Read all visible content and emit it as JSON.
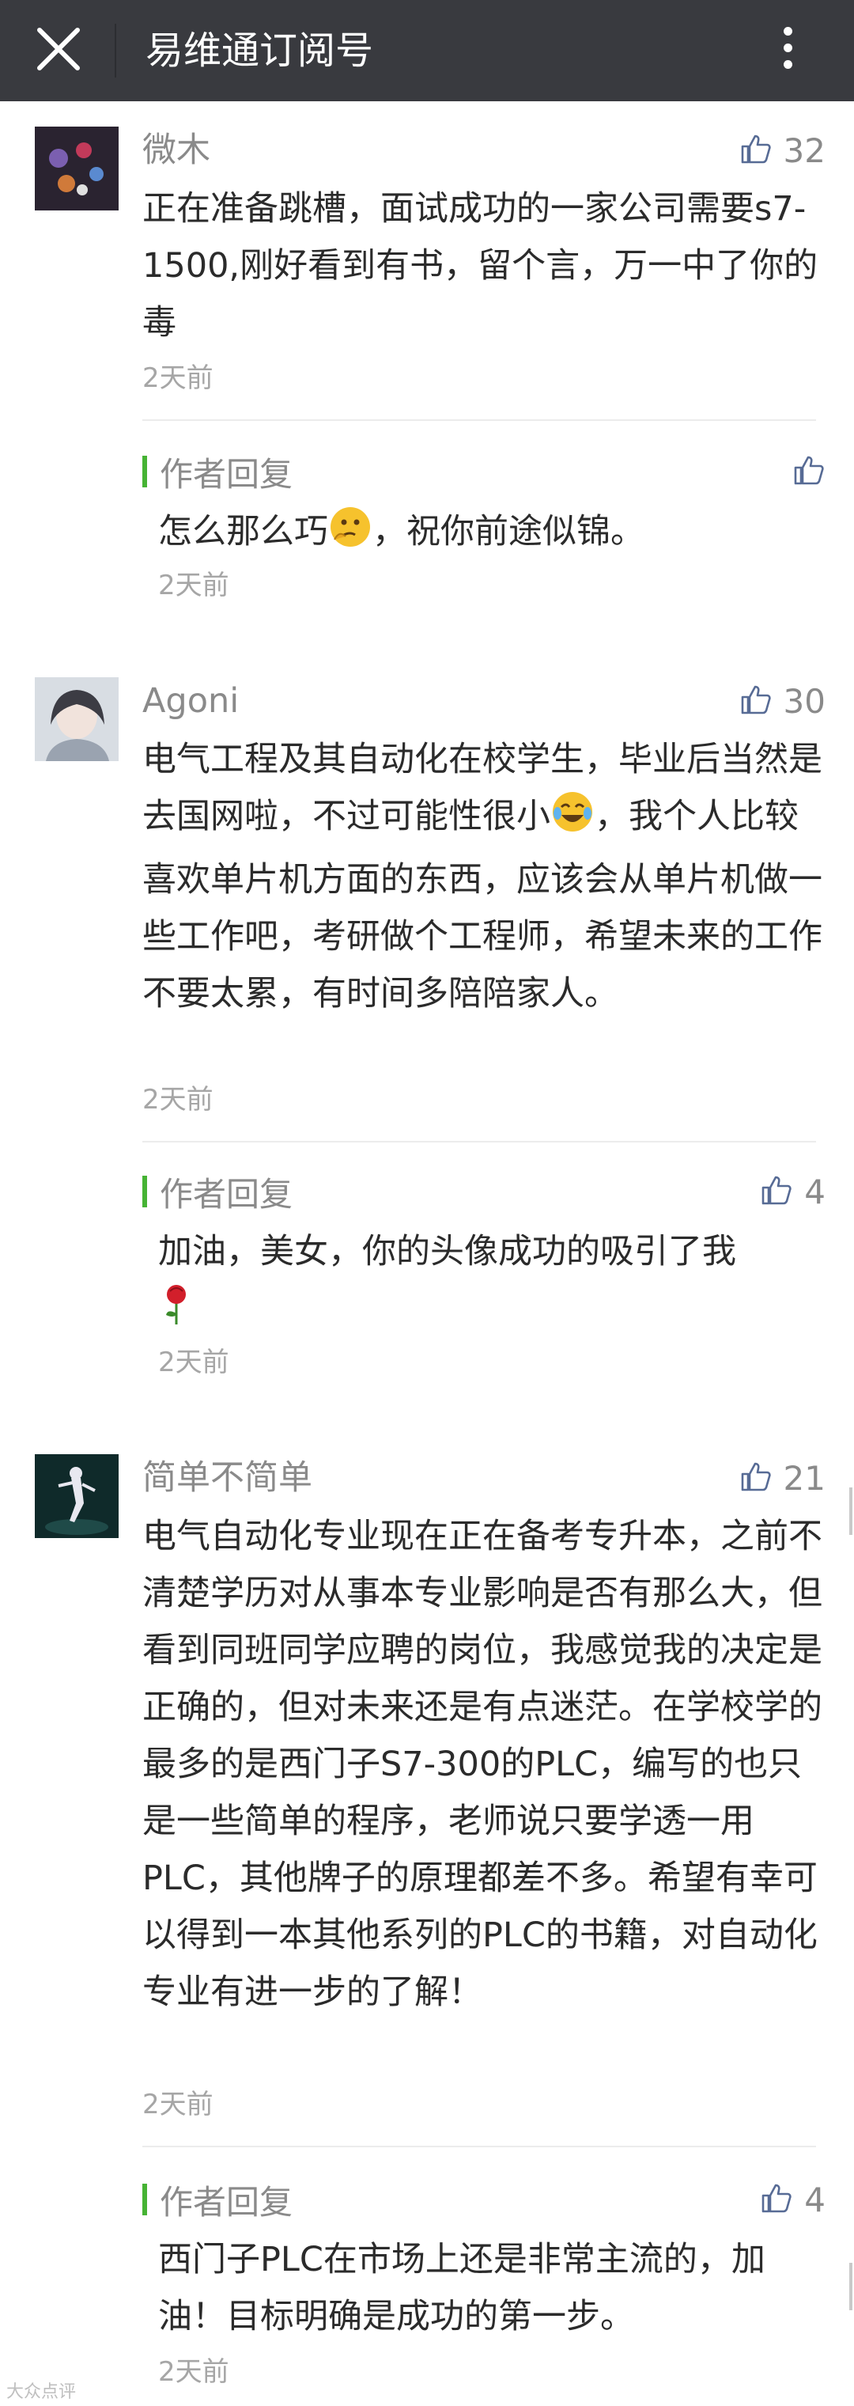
{
  "navbar": {
    "title": "易维通订阅号"
  },
  "comments": [
    {
      "nickname": "微木",
      "likes": "32",
      "content": "正在准备跳槽，面试成功的一家公司需要s7-1500,刚好看到有书，留个言，万一中了你的毒",
      "time": "2天前",
      "reply": {
        "label": "作者回复",
        "likes": "",
        "content_before": "怎么那么巧",
        "content_after": "，祝你前途似锦。",
        "time": "2天前"
      }
    },
    {
      "nickname": "Agoni",
      "likes": "30",
      "content_before": "电气工程及其自动化在校学生，毕业后当然是去国网啦，不过可能性很小",
      "content_after": "，我个人比较喜欢单片机方面的东西，应该会从单片机做一些工作吧，考研做个工程师，希望未来的工作不要太累，有时间多陪陪家人。",
      "time": "2天前",
      "reply": {
        "label": "作者回复",
        "likes": "4",
        "content": "加油，美女，你的头像成功的吸引了我",
        "time": "2天前"
      }
    },
    {
      "nickname": "简单不简单",
      "likes": "21",
      "content": "电气自动化专业现在正在备考专升本，之前不清楚学历对从事本专业影响是否有那么大，但看到同班同学应聘的岗位，我感觉我的决定是正确的，但对未来还是有点迷茫。在学校学的最多的是西门子S7-300的PLC，编写的也只是一些简单的程序，老师说只要学透一用PLC，其他牌子的原理都差不多。希望有幸可以得到一本其他系列的PLC的书籍，对自动化专业有进一步的了解！",
      "time": "2天前",
      "reply": {
        "label": "作者回复",
        "likes": "4",
        "content": "西门子PLC在市场上还是非常主流的，加油！目标明确是成功的第一步。",
        "time": "2天前"
      }
    }
  ],
  "colors": {
    "navbar_bg": "#393a3f",
    "reply_bar": "#46b334",
    "like_icon": "#576b95"
  },
  "watermark": "大众点评"
}
